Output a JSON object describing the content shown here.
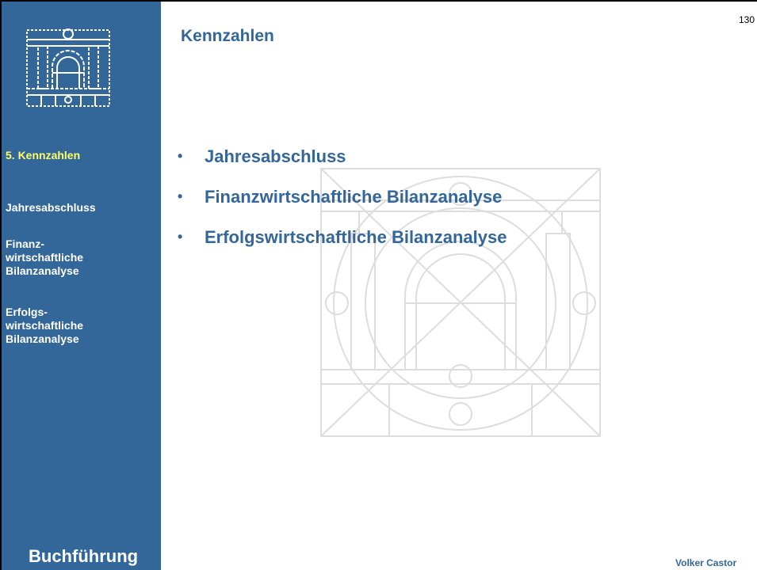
{
  "page_number": "130",
  "title": "Kennzahlen",
  "sidebar": {
    "current": "5. Kennzahlen",
    "items": [
      {
        "lines": [
          "Jahresabschluss"
        ]
      },
      {
        "lines": [
          "Finanz-",
          "wirtschaftliche",
          "Bilanzanalyse"
        ]
      },
      {
        "lines": [
          "Erfolgs-",
          "wirtschaftliche",
          "Bilanzanalyse"
        ]
      }
    ],
    "footer": "Buchführung"
  },
  "bullets": [
    "Jahresabschluss",
    "Finanzwirtschaftliche Bilanzanalyse",
    "Erfolgswirtschaftliche Bilanzanalyse"
  ],
  "author": "Volker Castor",
  "colors": {
    "sidebar_bg": "#336699",
    "accent": "#336699",
    "highlight": "#ffff66",
    "text_white": "#ffffff"
  },
  "icons": {
    "logo": "arch-portal-icon",
    "watermark": "arch-construction-drawing",
    "bullet": "•"
  }
}
